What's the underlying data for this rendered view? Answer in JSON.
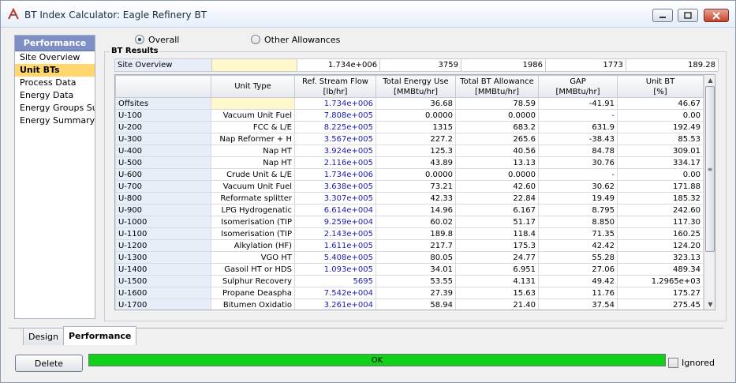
{
  "window": {
    "title": "BT Index Calculator: Eagle Refinery BT",
    "accent_color": "#7e8fc6",
    "status_color": "#11d11a",
    "icons": [
      "app-icon",
      "minimize-icon",
      "maximize-icon",
      "close-icon"
    ]
  },
  "nav": {
    "header": "Performance",
    "items": [
      "Site Overview",
      "Unit BTs",
      "Process Data",
      "Energy Data",
      "Energy Groups Sun",
      "Energy Summary"
    ],
    "selected": "Unit BTs"
  },
  "options": {
    "overall_label": "Overall",
    "other_label": "Other Allowances",
    "selected": "Overall"
  },
  "results": {
    "group_title": "BT Results",
    "site": {
      "label": "Site Overview",
      "unit_type": "",
      "flow": "1.734e+006",
      "energy_use": "3759",
      "bt_allowance": "1986",
      "gap": "1773",
      "unit_bt": "189.28"
    },
    "columns": [
      "",
      "Unit Type",
      "Ref. Stream Flow\n[lb/hr]",
      "Total Energy Use\n[MMBtu/hr]",
      "Total BT Allowance\n[MMBtu/hr]",
      "GAP\n[MMBtu/hr]",
      "Unit BT\n[%]"
    ],
    "rows": [
      [
        "Offsites",
        "",
        "1.734e+006",
        "36.68",
        "78.59",
        "-41.91",
        "46.67"
      ],
      [
        "U-100",
        "Vacuum Unit Fuel",
        "7.808e+005",
        "0.0000",
        "0.0000",
        "-",
        "0.00"
      ],
      [
        "U-200",
        "FCC & L/E",
        "8.225e+005",
        "1315",
        "683.2",
        "631.9",
        "192.49"
      ],
      [
        "U-300",
        "Nap Reformer + H",
        "3.567e+005",
        "227.2",
        "265.6",
        "-38.43",
        "85.53"
      ],
      [
        "U-400",
        "Nap HT",
        "3.924e+005",
        "125.3",
        "40.56",
        "84.78",
        "309.01"
      ],
      [
        "U-500",
        "Nap HT",
        "2.116e+005",
        "43.89",
        "13.13",
        "30.76",
        "334.17"
      ],
      [
        "U-600",
        "Crude Unit & L/E",
        "1.734e+006",
        "0.0000",
        "0.0000",
        "-",
        "0.00"
      ],
      [
        "U-700",
        "Vacuum Unit Fuel",
        "3.638e+005",
        "73.21",
        "42.60",
        "30.62",
        "171.88"
      ],
      [
        "U-800",
        "Reformate splitter",
        "3.307e+005",
        "42.33",
        "22.84",
        "19.49",
        "185.32"
      ],
      [
        "U-900",
        "LPG Hydrogenatic",
        "6.614e+004",
        "14.96",
        "6.167",
        "8.795",
        "242.60"
      ],
      [
        "U-1000",
        "Isomerisation (TIP",
        "9.259e+004",
        "60.02",
        "51.17",
        "8.850",
        "117.30"
      ],
      [
        "U-1100",
        "Isomerisation (TIP",
        "2.143e+005",
        "189.8",
        "118.4",
        "71.35",
        "160.25"
      ],
      [
        "U-1200",
        "Alkylation (HF)",
        "1.611e+005",
        "217.7",
        "175.3",
        "42.42",
        "124.20"
      ],
      [
        "U-1300",
        "VGO HT",
        "5.408e+005",
        "80.05",
        "24.77",
        "55.28",
        "323.13"
      ],
      [
        "U-1400",
        "Gasoil HT or HDS",
        "1.093e+005",
        "34.01",
        "6.951",
        "27.06",
        "489.34"
      ],
      [
        "U-1500",
        "Sulphur Recovery",
        "5695",
        "53.55",
        "4.131",
        "49.42",
        "1.2965e+03"
      ],
      [
        "U-1600",
        "Propane Deaspha",
        "7.542e+004",
        "27.39",
        "15.63",
        "11.76",
        "175.27"
      ],
      [
        "U-1700",
        "Bitumen Oxidatio",
        "3.261e+004",
        "58.94",
        "21.40",
        "37.54",
        "275.45"
      ]
    ]
  },
  "tabs": {
    "items": [
      "Design",
      "Performance"
    ],
    "active": "Performance"
  },
  "footer": {
    "delete_label": "Delete",
    "status_text": "OK",
    "ignored_label": "Ignored",
    "ignored_checked": false
  }
}
